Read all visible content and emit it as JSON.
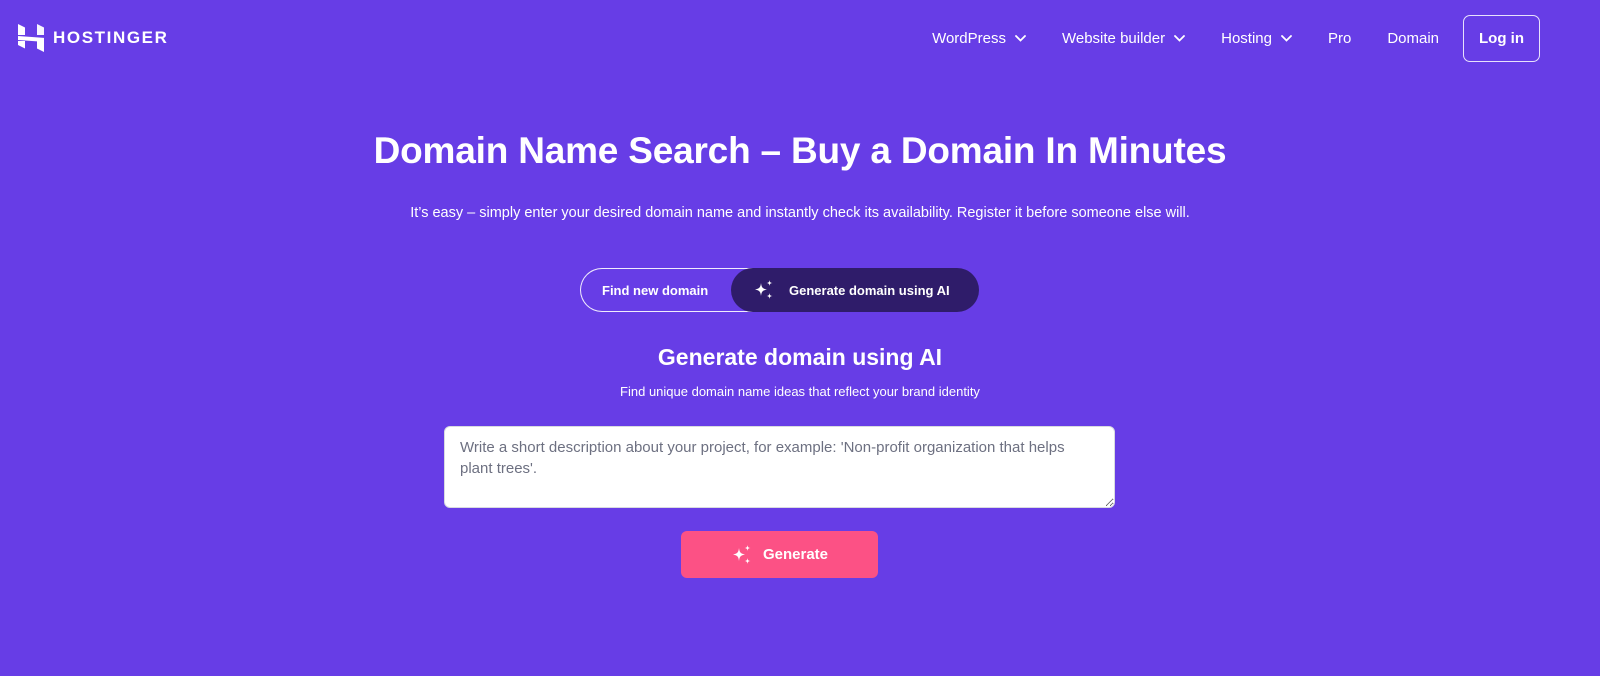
{
  "brand": {
    "name": "HOSTINGER",
    "logo_icon": "hostinger-h-logo"
  },
  "nav": {
    "items": [
      {
        "label": "WordPress",
        "has_dropdown": true,
        "icon": "chevron-down-icon"
      },
      {
        "label": "Website builder",
        "has_dropdown": true,
        "icon": "chevron-down-icon"
      },
      {
        "label": "Hosting",
        "has_dropdown": true,
        "icon": "chevron-down-icon"
      },
      {
        "label": "Pro",
        "has_dropdown": false
      },
      {
        "label": "Domain",
        "has_dropdown": false
      }
    ],
    "login_label": "Log in"
  },
  "hero": {
    "title": "Domain Name Search – Buy a Domain In Minutes",
    "subtitle": "It’s easy – simply enter your desired domain name and instantly check its availability. Register it before someone else will."
  },
  "mode_toggle": {
    "options": [
      {
        "label": "Find new domain",
        "selected": false
      },
      {
        "label": "Generate domain using AI",
        "selected": true,
        "icon": "sparkle-icon"
      }
    ]
  },
  "ai_section": {
    "title": "Generate domain using AI",
    "subtitle": "Find unique domain name ideas that reflect your brand identity",
    "description_input": {
      "value": "",
      "placeholder": "Write a short description about your project, for example: 'Non-profit organization that helps plant trees'."
    },
    "generate_label": "Generate",
    "generate_icon": "sparkle-icon"
  },
  "colors": {
    "background": "#673de6",
    "toggle_selected": "#2f1c6a",
    "generate_button": "#fc5185",
    "text": "#ffffff"
  }
}
